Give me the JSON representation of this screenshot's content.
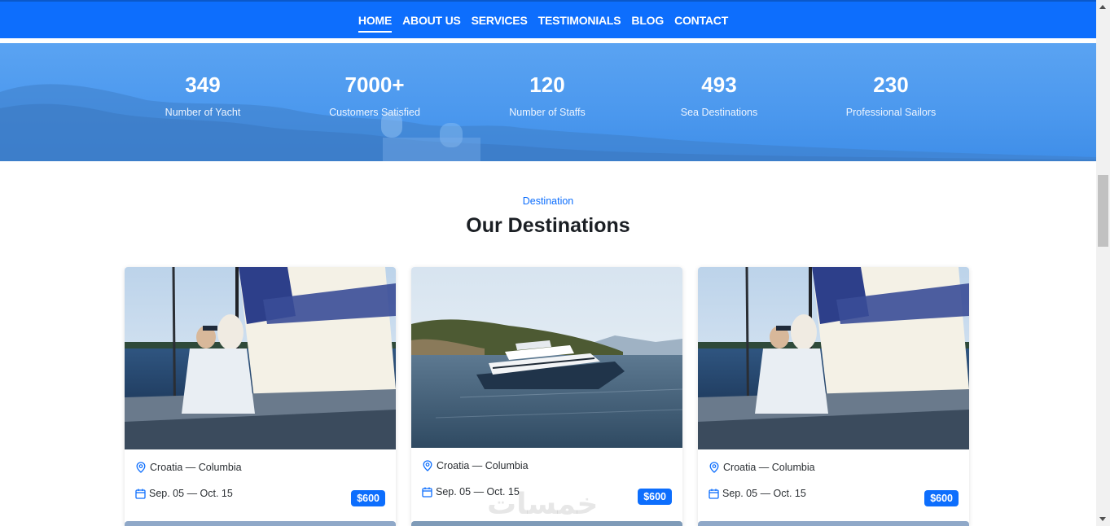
{
  "nav": {
    "items": [
      {
        "label": "HOME",
        "active": true
      },
      {
        "label": "ABOUT US",
        "active": false
      },
      {
        "label": "SERVICES",
        "active": false
      },
      {
        "label": "TESTIMONIALS",
        "active": false
      },
      {
        "label": "BLOG",
        "active": false
      },
      {
        "label": "CONTACT",
        "active": false
      }
    ],
    "color": "#0d6efd"
  },
  "stats": [
    {
      "number": "349",
      "label": "Number of Yacht"
    },
    {
      "number": "7000+",
      "label": "Customers Satisfied"
    },
    {
      "number": "120",
      "label": "Number of Staffs"
    },
    {
      "number": "493",
      "label": "Sea Destinations"
    },
    {
      "number": "230",
      "label": "Professional Sailors"
    }
  ],
  "section": {
    "subheading": "Destination",
    "heading": "Our Destinations"
  },
  "cards": [
    {
      "image": "sailboat-couple-photo",
      "location": "Croatia — Columbia",
      "dates": "Sep. 05 — Oct. 15",
      "price": "$600"
    },
    {
      "image": "motor-yacht-photo",
      "location": "Croatia — Columbia",
      "dates": "Sep. 05 — Oct. 15",
      "price": "$600"
    },
    {
      "image": "sailboat-couple-photo",
      "location": "Croatia — Columbia",
      "dates": "Sep. 05 — Oct. 15",
      "price": "$600"
    }
  ],
  "watermark": "خمسات",
  "colors": {
    "accent": "#0d6efd",
    "banner": "#4b98ee"
  }
}
